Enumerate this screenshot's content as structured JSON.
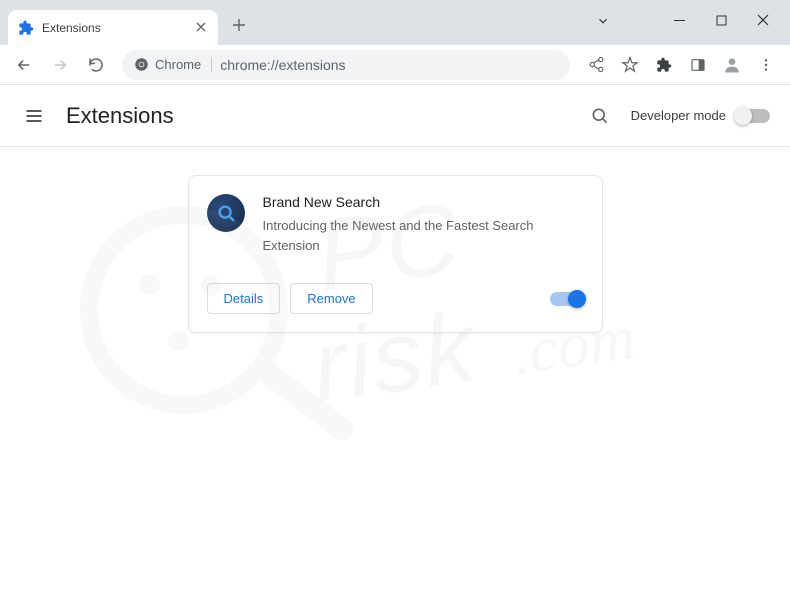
{
  "tab": {
    "title": "Extensions"
  },
  "omnibox": {
    "chip": "Chrome",
    "url": "chrome://extensions"
  },
  "header": {
    "title": "Extensions",
    "dev_mode_label": "Developer mode"
  },
  "extension": {
    "name": "Brand New Search",
    "description": "Introducing the Newest and the Fastest Search Extension",
    "details_label": "Details",
    "remove_label": "Remove"
  },
  "watermark": {
    "line1": "PC",
    "line2": "risk",
    "suffix": ".com"
  }
}
